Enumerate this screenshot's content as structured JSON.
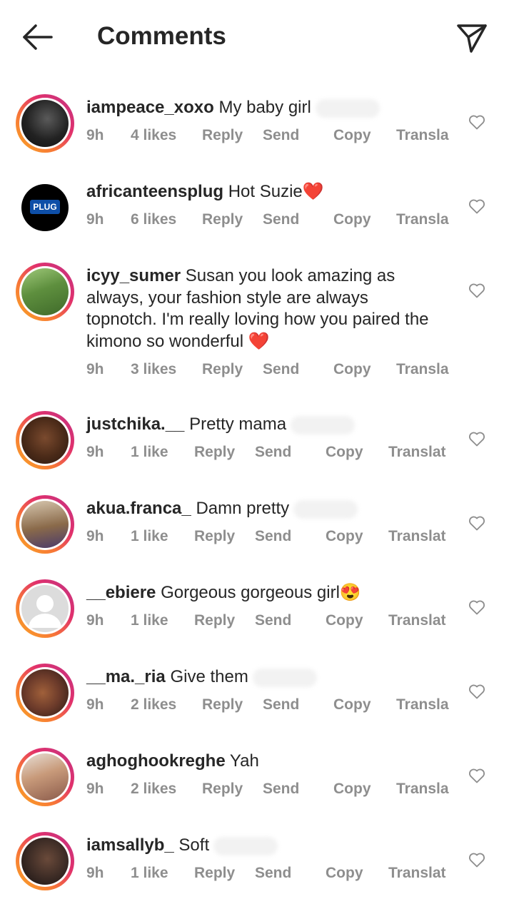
{
  "header": {
    "title": "Comments",
    "back_icon": "arrow-left-icon",
    "share_icon": "paper-plane-icon"
  },
  "comments": [
    {
      "username": "iampeace_xoxo",
      "text": "My baby girl",
      "emoji": "",
      "time": "9h",
      "likes": "4 likes",
      "reply": "Reply",
      "send": "Send",
      "copy": "Copy",
      "translate": "Transla",
      "avatar_color": "#2c2c2c",
      "story": true
    },
    {
      "username": "africanteensplug",
      "text": "Hot Suzie",
      "emoji": "❤️",
      "time": "9h",
      "likes": "6 likes",
      "reply": "Reply",
      "send": "Send",
      "copy": "Copy",
      "translate": "Transla",
      "avatar_color": "#000000",
      "avatar_label": "PLUG",
      "story": false
    },
    {
      "username": "icyy_sumer",
      "text": "Susan you look amazing as always, your fashion style are always topnotch. I'm really loving how you paired the kimono so wonderful",
      "emoji": "❤️",
      "time": "9h",
      "likes": "3 likes",
      "reply": "Reply",
      "send": "Send",
      "copy": "Copy",
      "translate": "Transla",
      "avatar_color": "#6a9a4a",
      "story": true
    },
    {
      "username": "justchika.__",
      "text": "Pretty mama",
      "emoji": "",
      "time": "9h",
      "likes": "1 like",
      "reply": "Reply",
      "send": "Send",
      "copy": "Copy",
      "translate": "Translat",
      "avatar_color": "#5a3320",
      "story": true
    },
    {
      "username": "akua.franca_",
      "text": "Damn pretty",
      "emoji": "",
      "time": "9h",
      "likes": "1 like",
      "reply": "Reply",
      "send": "Send",
      "copy": "Copy",
      "translate": "Translat",
      "avatar_color": "#8a6a4a",
      "story": true
    },
    {
      "username": "__ebiere",
      "text": "Gorgeous gorgeous girl",
      "emoji": "😍",
      "time": "9h",
      "likes": "1 like",
      "reply": "Reply",
      "send": "Send",
      "copy": "Copy",
      "translate": "Translat",
      "avatar_color": "#d9d9d9",
      "story": true
    },
    {
      "username": "__ma._ria",
      "text": "Give them",
      "emoji": "",
      "time": "9h",
      "likes": "2 likes",
      "reply": "Reply",
      "send": "Send",
      "copy": "Copy",
      "translate": "Transla",
      "avatar_color": "#6b3a2a",
      "story": true
    },
    {
      "username": "aghoghookreghe",
      "text": "Yah",
      "emoji": "",
      "time": "9h",
      "likes": "2 likes",
      "reply": "Reply",
      "send": "Send",
      "copy": "Copy",
      "translate": "Transla",
      "avatar_color": "#b58a6a",
      "story": true
    },
    {
      "username": "iamsallyb_",
      "text": "Soft",
      "emoji": "",
      "time": "9h",
      "likes": "1 like",
      "reply": "Reply",
      "send": "Send",
      "copy": "Copy",
      "translate": "Translat",
      "avatar_color": "#3a2a24",
      "story": true
    }
  ]
}
